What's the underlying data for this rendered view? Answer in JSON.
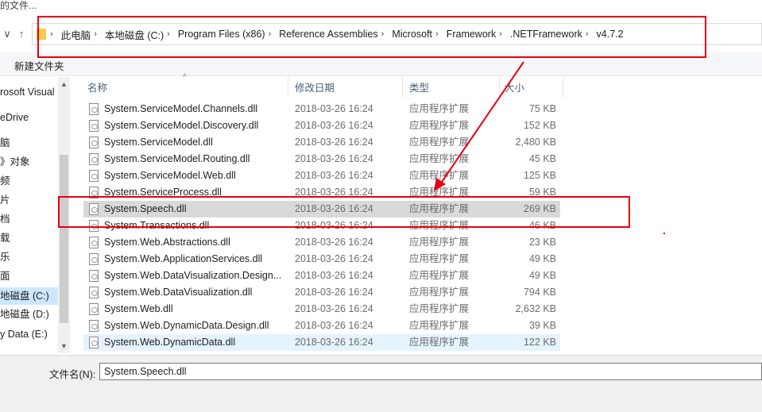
{
  "window": {
    "title_fragment": "的文件..."
  },
  "nav_buttons": {
    "dropdown_glyph": "∨",
    "up_glyph": "↑"
  },
  "address": {
    "separator": "›",
    "crumbs": [
      "此电脑",
      "本地磁盘 (C:)",
      "Program Files (x86)",
      "Reference Assemblies",
      "Microsoft",
      "Framework",
      ".NETFramework",
      "v4.7.2"
    ]
  },
  "toolbar": {
    "new_folder_label": "新建文件夹"
  },
  "nav_pane": {
    "items": [
      {
        "label": "rosoft Visual"
      },
      {
        "label": "eDrive"
      },
      {
        "label": "脑"
      },
      {
        "label": "》对象"
      },
      {
        "label": "频"
      },
      {
        "label": "片"
      },
      {
        "label": "档"
      },
      {
        "label": "载"
      },
      {
        "label": "乐"
      },
      {
        "label": "面"
      },
      {
        "label": "地磁盘 (C:)",
        "selected": true
      },
      {
        "label": "地磁盘 (D:)"
      },
      {
        "label": "y Data (E:)"
      }
    ],
    "scroll_up_glyph": "▲",
    "scroll_down_glyph": "▼"
  },
  "columns": {
    "name": "名称",
    "date": "修改日期",
    "type": "类型",
    "size": "大小",
    "sort_glyph": "^"
  },
  "files": [
    {
      "name": "System.ServiceModel.Channels.dll",
      "date": "2018-03-26 16:24",
      "type": "应用程序扩展",
      "size": "75 KB"
    },
    {
      "name": "System.ServiceModel.Discovery.dll",
      "date": "2018-03-26 16:24",
      "type": "应用程序扩展",
      "size": "152 KB"
    },
    {
      "name": "System.ServiceModel.dll",
      "date": "2018-03-26 16:24",
      "type": "应用程序扩展",
      "size": "2,480 KB"
    },
    {
      "name": "System.ServiceModel.Routing.dll",
      "date": "2018-03-26 16:24",
      "type": "应用程序扩展",
      "size": "45 KB"
    },
    {
      "name": "System.ServiceModel.Web.dll",
      "date": "2018-03-26 16:24",
      "type": "应用程序扩展",
      "size": "125 KB"
    },
    {
      "name": "System.ServiceProcess.dll",
      "date": "2018-03-26 16:24",
      "type": "应用程序扩展",
      "size": "59 KB"
    },
    {
      "name": "System.Speech.dll",
      "date": "2018-03-26 16:24",
      "type": "应用程序扩展",
      "size": "269 KB",
      "state": "selected"
    },
    {
      "name": "System.Transactions.dll",
      "date": "2018-03-26 16:24",
      "type": "应用程序扩展",
      "size": "46 KB"
    },
    {
      "name": "System.Web.Abstractions.dll",
      "date": "2018-03-26 16:24",
      "type": "应用程序扩展",
      "size": "23 KB"
    },
    {
      "name": "System.Web.ApplicationServices.dll",
      "date": "2018-03-26 16:24",
      "type": "应用程序扩展",
      "size": "49 KB"
    },
    {
      "name": "System.Web.DataVisualization.Design...",
      "date": "2018-03-26 16:24",
      "type": "应用程序扩展",
      "size": "49 KB"
    },
    {
      "name": "System.Web.DataVisualization.dll",
      "date": "2018-03-26 16:24",
      "type": "应用程序扩展",
      "size": "794 KB"
    },
    {
      "name": "System.Web.dll",
      "date": "2018-03-26 16:24",
      "type": "应用程序扩展",
      "size": "2,632 KB"
    },
    {
      "name": "System.Web.DynamicData.Design.dll",
      "date": "2018-03-26 16:24",
      "type": "应用程序扩展",
      "size": "39 KB"
    },
    {
      "name": "System.Web.DynamicData.dll",
      "date": "2018-03-26 16:24",
      "type": "应用程序扩展",
      "size": "122 KB",
      "state": "hover"
    }
  ],
  "filename": {
    "label": "文件名(N):",
    "value": "System.Speech.dll"
  },
  "colors": {
    "annotation": "#e60012",
    "selection": "#d9d9d9",
    "hover": "#e5f3ff",
    "nav_selection": "#cce8ff"
  }
}
